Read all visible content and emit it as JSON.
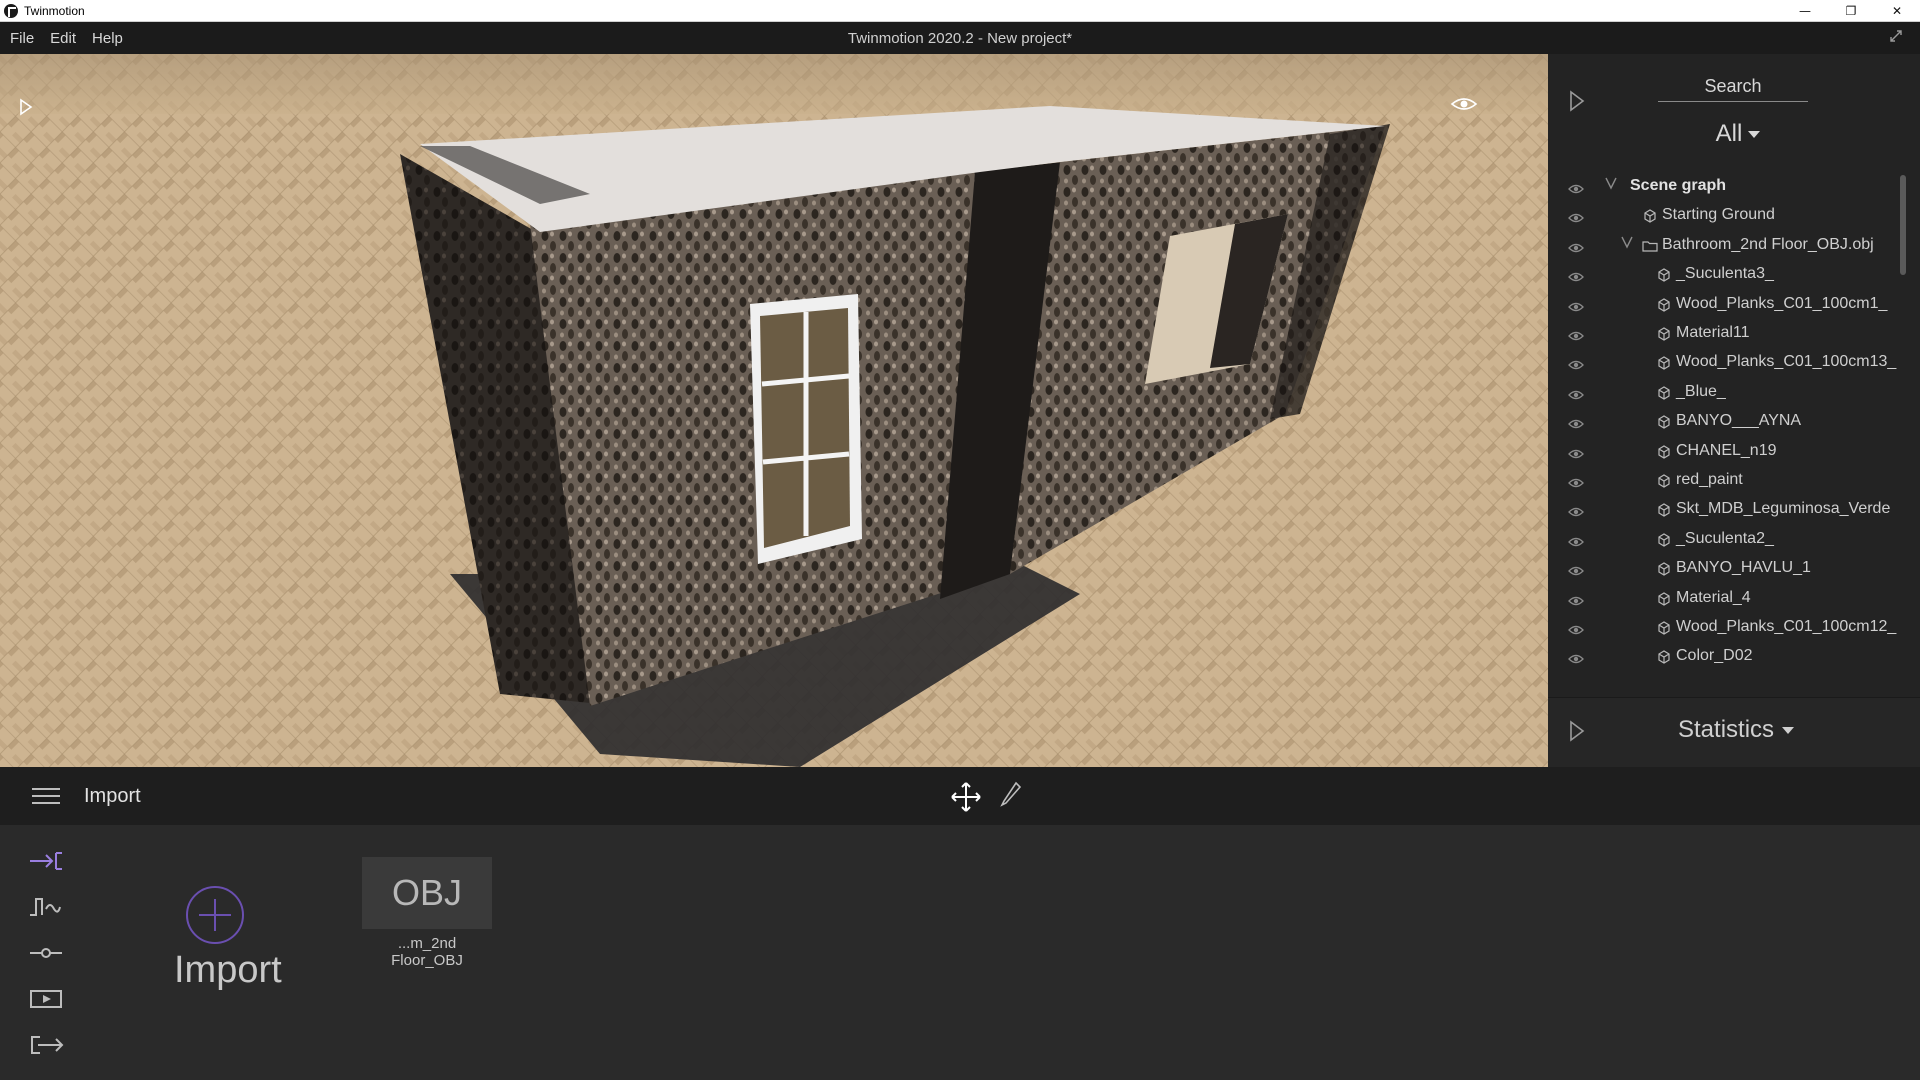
{
  "window": {
    "app_title": "Twinmotion",
    "minimize": "—",
    "restore": "❐",
    "close": "✕"
  },
  "menubar": {
    "items": [
      "File",
      "Edit",
      "Help"
    ],
    "title": "Twinmotion 2020.2 - New project*"
  },
  "right_panel": {
    "search_label": "Search",
    "filter": "All",
    "tree": [
      {
        "label": "Scene graph",
        "level": 0,
        "kind": "root",
        "expanded": true
      },
      {
        "label": "Starting Ground",
        "level": 1,
        "kind": "mesh"
      },
      {
        "label": "Bathroom_2nd Floor_OBJ.obj",
        "level": 1,
        "kind": "folder",
        "expanded": true
      },
      {
        "label": "_Suculenta3_",
        "level": 2,
        "kind": "mesh"
      },
      {
        "label": "Wood_Planks_C01_100cm1_",
        "level": 2,
        "kind": "mesh"
      },
      {
        "label": "Material11",
        "level": 2,
        "kind": "mesh"
      },
      {
        "label": "Wood_Planks_C01_100cm13_",
        "level": 2,
        "kind": "mesh"
      },
      {
        "label": "_Blue_",
        "level": 2,
        "kind": "mesh"
      },
      {
        "label": "BANYO___AYNA",
        "level": 2,
        "kind": "mesh"
      },
      {
        "label": "CHANEL_n19",
        "level": 2,
        "kind": "mesh"
      },
      {
        "label": "red_paint",
        "level": 2,
        "kind": "mesh"
      },
      {
        "label": "Skt_MDB_Leguminosa_Verde",
        "level": 2,
        "kind": "mesh"
      },
      {
        "label": "_Suculenta2_",
        "level": 2,
        "kind": "mesh"
      },
      {
        "label": "BANYO_HAVLU_1",
        "level": 2,
        "kind": "mesh"
      },
      {
        "label": "Material_4",
        "level": 2,
        "kind": "mesh"
      },
      {
        "label": "Wood_Planks_C01_100cm12_",
        "level": 2,
        "kind": "mesh"
      },
      {
        "label": "Color_D02",
        "level": 2,
        "kind": "mesh"
      }
    ],
    "statistics_label": "Statistics"
  },
  "bottom": {
    "section_title": "Import",
    "import_label": "Import",
    "obj_tile_text": "OBJ",
    "obj_tile_label": "...m_2nd Floor_OBJ",
    "side_tools": [
      "import-tool-icon",
      "waveform-tool-icon",
      "slider-tool-icon",
      "media-tool-icon",
      "export-tool-icon"
    ]
  },
  "colors": {
    "accent_purple": "#7a5fc0",
    "panel_bg": "#232323",
    "toolbar_bg": "#1e1e1e"
  }
}
